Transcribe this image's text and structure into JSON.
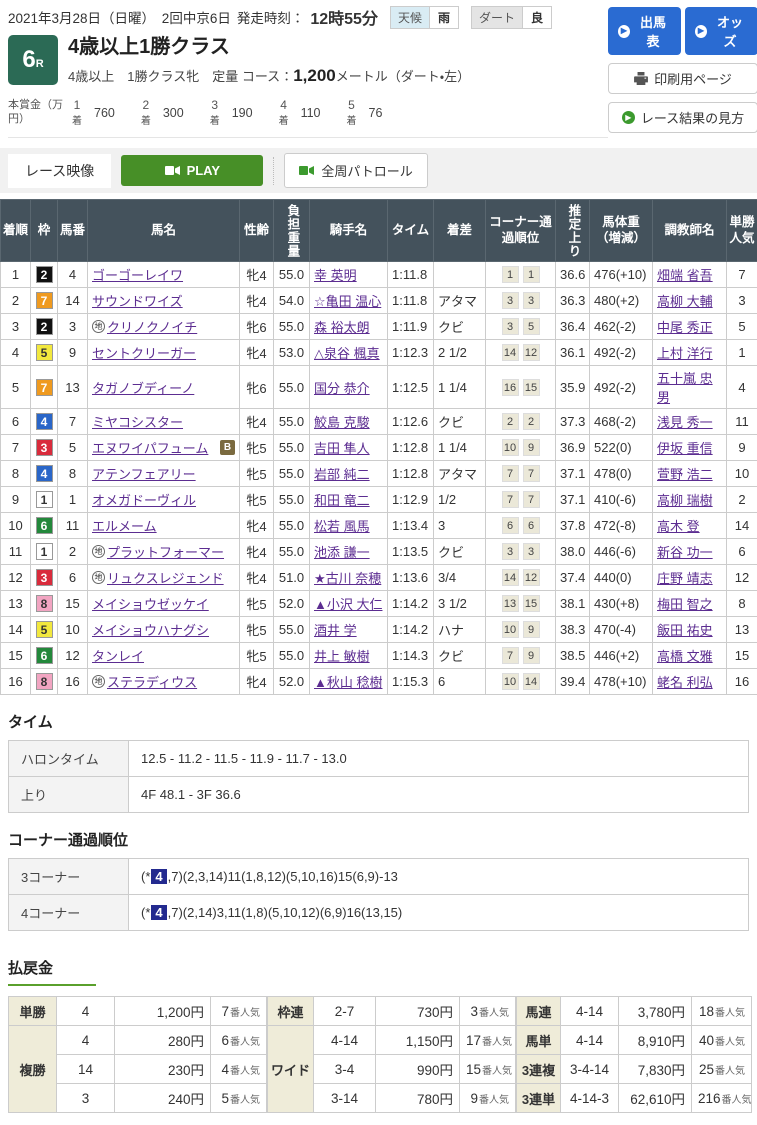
{
  "colors": {
    "button_blue": "#2a6bd2",
    "race_badge_green": "#2b6a55",
    "play_green": "#478f27",
    "table_header_bg": "#44525c",
    "link_purple": "#5c2d91",
    "corner_highlight_bg": "#232a8f",
    "payout_label_bg": "#efecd9",
    "corner_box_bg": "#ebe8d8",
    "section_underline_green": "#5aa02c",
    "waku": {
      "1": [
        "#ffffff",
        "#333333"
      ],
      "2": [
        "#111111",
        "#ffffff"
      ],
      "3": [
        "#d92b3c",
        "#ffffff"
      ],
      "4": [
        "#2a66c8",
        "#ffffff"
      ],
      "5": [
        "#f2e83e",
        "#333333"
      ],
      "6": [
        "#23883b",
        "#ffffff"
      ],
      "7": [
        "#ef9a1f",
        "#ffffff"
      ],
      "8": [
        "#f2a5c2",
        "#333333"
      ]
    }
  },
  "header": {
    "date_line": "2021年3月28日（日曜）　2回中京6日",
    "start_label": "発走時刻：",
    "start_time": "12時55分",
    "weather_label": "天候",
    "weather_value": "雨",
    "track_label": "ダート",
    "track_value": "良",
    "buttons": {
      "entry": "出馬表",
      "odds": "オッズ",
      "print": "印刷用ページ",
      "guide": "レース結果の見方"
    }
  },
  "race": {
    "number": "6",
    "number_suffix": "R",
    "title": "4歳以上1勝クラス",
    "conditions": "4歳以上　1勝クラス牝　定量",
    "course_label": "コース：",
    "course_distance": "1,200",
    "course_suffix": "メートル（ダート・左）",
    "prize_label": "本賞金（万円）",
    "place_suffix": "着",
    "prizes": [
      {
        "place": "1",
        "amount": "760"
      },
      {
        "place": "2",
        "amount": "300"
      },
      {
        "place": "3",
        "amount": "190"
      },
      {
        "place": "4",
        "amount": "110"
      },
      {
        "place": "5",
        "amount": "76"
      }
    ]
  },
  "video": {
    "tab": "レース映像",
    "play": "PLAY",
    "patrol": "全周パトロール"
  },
  "results": {
    "headers": [
      "着順",
      "枠",
      "馬番",
      "馬名",
      "性齢",
      "負担重量",
      "騎手名",
      "タイム",
      "着差",
      "コーナー通過順位",
      "推定上り",
      "馬体重（増減）",
      "調教師名",
      "単勝人気"
    ],
    "rows": [
      {
        "rank": "1",
        "waku": "2",
        "num": "4",
        "mark": "",
        "name": "ゴーゴーレイワ",
        "badge": "",
        "sexage": "牝4",
        "weight": "55.0",
        "jockey": "幸 英明",
        "time": "1:11.8",
        "margin": "",
        "c1": "1",
        "c2": "1",
        "agari": "36.6",
        "body": "476(+10)",
        "trainer": "畑端 省吾",
        "pop": "7"
      },
      {
        "rank": "2",
        "waku": "7",
        "num": "14",
        "mark": "",
        "name": "サウンドワイズ",
        "badge": "",
        "sexage": "牝4",
        "weight": "54.0",
        "jockey": "☆亀田 温心",
        "time": "1:11.8",
        "margin": "アタマ",
        "c1": "3",
        "c2": "3",
        "agari": "36.3",
        "body": "480(+2)",
        "trainer": "高柳 大輔",
        "pop": "3"
      },
      {
        "rank": "3",
        "waku": "2",
        "num": "3",
        "mark": "地",
        "name": "クリノクノイチ",
        "badge": "",
        "sexage": "牝6",
        "weight": "55.0",
        "jockey": "森 裕太朗",
        "time": "1:11.9",
        "margin": "クビ",
        "c1": "3",
        "c2": "5",
        "agari": "36.4",
        "body": "462(-2)",
        "trainer": "中尾 秀正",
        "pop": "5"
      },
      {
        "rank": "4",
        "waku": "5",
        "num": "9",
        "mark": "",
        "name": "セントクリーガー",
        "badge": "",
        "sexage": "牝4",
        "weight": "53.0",
        "jockey": "△泉谷 楓真",
        "time": "1:12.3",
        "margin": "2 1/2",
        "c1": "14",
        "c2": "12",
        "agari": "36.1",
        "body": "492(-2)",
        "trainer": "上村 洋行",
        "pop": "1"
      },
      {
        "rank": "5",
        "waku": "7",
        "num": "13",
        "mark": "",
        "name": "タガノブディーノ",
        "badge": "",
        "sexage": "牝6",
        "weight": "55.0",
        "jockey": "国分 恭介",
        "time": "1:12.5",
        "margin": "1 1/4",
        "c1": "16",
        "c2": "15",
        "agari": "35.9",
        "body": "492(-2)",
        "trainer": "五十嵐 忠男",
        "pop": "4"
      },
      {
        "rank": "6",
        "waku": "4",
        "num": "7",
        "mark": "",
        "name": "ミヤコシスター",
        "badge": "",
        "sexage": "牝4",
        "weight": "55.0",
        "jockey": "鮫島 克駿",
        "time": "1:12.6",
        "margin": "クビ",
        "c1": "2",
        "c2": "2",
        "agari": "37.3",
        "body": "468(-2)",
        "trainer": "浅見 秀一",
        "pop": "11"
      },
      {
        "rank": "7",
        "waku": "3",
        "num": "5",
        "mark": "",
        "name": "エヌワイパフューム",
        "badge": "B",
        "sexage": "牝5",
        "weight": "55.0",
        "jockey": "吉田 隼人",
        "time": "1:12.8",
        "margin": "1 1/4",
        "c1": "10",
        "c2": "9",
        "agari": "36.9",
        "body": "522(0)",
        "trainer": "伊坂 重信",
        "pop": "9"
      },
      {
        "rank": "8",
        "waku": "4",
        "num": "8",
        "mark": "",
        "name": "アテンフェアリー",
        "badge": "",
        "sexage": "牝5",
        "weight": "55.0",
        "jockey": "岩部 純二",
        "time": "1:12.8",
        "margin": "アタマ",
        "c1": "7",
        "c2": "7",
        "agari": "37.1",
        "body": "478(0)",
        "trainer": "萱野 浩二",
        "pop": "10"
      },
      {
        "rank": "9",
        "waku": "1",
        "num": "1",
        "mark": "",
        "name": "オメガドーヴィル",
        "badge": "",
        "sexage": "牝5",
        "weight": "55.0",
        "jockey": "和田 竜二",
        "time": "1:12.9",
        "margin": "1/2",
        "c1": "7",
        "c2": "7",
        "agari": "37.1",
        "body": "410(-6)",
        "trainer": "高柳 瑞樹",
        "pop": "2"
      },
      {
        "rank": "10",
        "waku": "6",
        "num": "11",
        "mark": "",
        "name": "エルメーム",
        "badge": "",
        "sexage": "牝4",
        "weight": "55.0",
        "jockey": "松若 風馬",
        "time": "1:13.4",
        "margin": "3",
        "c1": "6",
        "c2": "6",
        "agari": "37.8",
        "body": "472(-8)",
        "trainer": "高木 登",
        "pop": "14"
      },
      {
        "rank": "11",
        "waku": "1",
        "num": "2",
        "mark": "地",
        "name": "プラットフォーマー",
        "badge": "",
        "sexage": "牝4",
        "weight": "55.0",
        "jockey": "池添 謙一",
        "time": "1:13.5",
        "margin": "クビ",
        "c1": "3",
        "c2": "3",
        "agari": "38.0",
        "body": "446(-6)",
        "trainer": "新谷 功一",
        "pop": "6"
      },
      {
        "rank": "12",
        "waku": "3",
        "num": "6",
        "mark": "地",
        "name": "リュクスレジェンド",
        "badge": "",
        "sexage": "牝4",
        "weight": "51.0",
        "jockey": "★古川 奈穂",
        "time": "1:13.6",
        "margin": "3/4",
        "c1": "14",
        "c2": "12",
        "agari": "37.4",
        "body": "440(0)",
        "trainer": "庄野 靖志",
        "pop": "12"
      },
      {
        "rank": "13",
        "waku": "8",
        "num": "15",
        "mark": "",
        "name": "メイショウゼッケイ",
        "badge": "",
        "sexage": "牝5",
        "weight": "52.0",
        "jockey": "▲小沢 大仁",
        "time": "1:14.2",
        "margin": "3 1/2",
        "c1": "13",
        "c2": "15",
        "agari": "38.1",
        "body": "430(+8)",
        "trainer": "梅田 智之",
        "pop": "8"
      },
      {
        "rank": "14",
        "waku": "5",
        "num": "10",
        "mark": "",
        "name": "メイショウハナグシ",
        "badge": "",
        "sexage": "牝5",
        "weight": "55.0",
        "jockey": "酒井 学",
        "time": "1:14.2",
        "margin": "ハナ",
        "c1": "10",
        "c2": "9",
        "agari": "38.3",
        "body": "470(-4)",
        "trainer": "飯田 祐史",
        "pop": "13"
      },
      {
        "rank": "15",
        "waku": "6",
        "num": "12",
        "mark": "",
        "name": "タンレイ",
        "badge": "",
        "sexage": "牝5",
        "weight": "55.0",
        "jockey": "井上 敏樹",
        "time": "1:14.3",
        "margin": "クビ",
        "c1": "7",
        "c2": "9",
        "agari": "38.5",
        "body": "446(+2)",
        "trainer": "高橋 文雅",
        "pop": "15"
      },
      {
        "rank": "16",
        "waku": "8",
        "num": "16",
        "mark": "地",
        "name": "ステラディウス",
        "badge": "",
        "sexage": "牝4",
        "weight": "52.0",
        "jockey": "▲秋山 稔樹",
        "time": "1:15.3",
        "margin": "6",
        "c1": "10",
        "c2": "14",
        "agari": "39.4",
        "body": "478(+10)",
        "trainer": "蛯名 利弘",
        "pop": "16"
      }
    ]
  },
  "time_section": {
    "title": "タイム",
    "rows": [
      {
        "label": "ハロンタイム",
        "value": "12.5 - 11.2 - 11.5 - 11.9 - 11.7 - 13.0"
      },
      {
        "label": "上り",
        "value": "4F 48.1 - 3F 36.6"
      }
    ]
  },
  "corner_section": {
    "title": "コーナー通過順位",
    "rows": [
      {
        "label": "3コーナー",
        "prefix": "(*",
        "highlight": "4",
        "suffix": ",7)(2,3,14)11(1,8,12)(5,10,16)15(6,9)-13"
      },
      {
        "label": "4コーナー",
        "prefix": "(*",
        "highlight": "4",
        "suffix": ",7)(2,14)3,11(1,8)(5,10,12)(6,9)16(13,15)"
      }
    ]
  },
  "payout_section": {
    "title": "払戻金",
    "pop_suffix": "番人気",
    "groups": [
      {
        "bets": [
          {
            "label": "単勝",
            "rows": [
              {
                "num": "4",
                "amount": "1,200円",
                "pop": "7"
              }
            ]
          },
          {
            "label": "複勝",
            "rows": [
              {
                "num": "4",
                "amount": "280円",
                "pop": "6"
              },
              {
                "num": "14",
                "amount": "230円",
                "pop": "4"
              },
              {
                "num": "3",
                "amount": "240円",
                "pop": "5"
              }
            ]
          }
        ]
      },
      {
        "bets": [
          {
            "label": "枠連",
            "rows": [
              {
                "num": "2-7",
                "amount": "730円",
                "pop": "3"
              }
            ]
          },
          {
            "label": "ワイド",
            "rows": [
              {
                "num": "4-14",
                "amount": "1,150円",
                "pop": "17"
              },
              {
                "num": "3-4",
                "amount": "990円",
                "pop": "15"
              },
              {
                "num": "3-14",
                "amount": "780円",
                "pop": "9"
              }
            ]
          }
        ]
      },
      {
        "bets": [
          {
            "label": "馬連",
            "rows": [
              {
                "num": "4-14",
                "amount": "3,780円",
                "pop": "18"
              }
            ]
          },
          {
            "label": "馬単",
            "rows": [
              {
                "num": "4-14",
                "amount": "8,910円",
                "pop": "40"
              }
            ]
          },
          {
            "label": "3連複",
            "rows": [
              {
                "num": "3-4-14",
                "amount": "7,830円",
                "pop": "25"
              }
            ]
          },
          {
            "label": "3連単",
            "rows": [
              {
                "num": "4-14-3",
                "amount": "62,610円",
                "pop": "216"
              }
            ]
          }
        ]
      }
    ]
  }
}
